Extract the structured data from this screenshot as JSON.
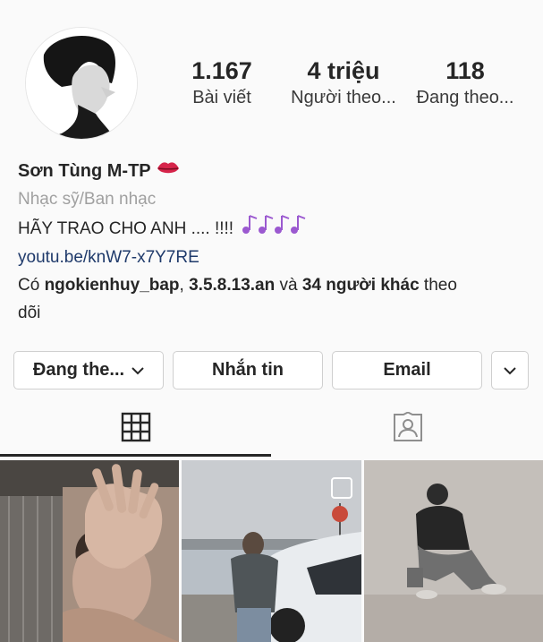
{
  "profile": {
    "stats": [
      {
        "value": "1.167",
        "label": "Bài viết"
      },
      {
        "value": "4 triệu",
        "label": "Người theo..."
      },
      {
        "value": "118",
        "label": "Đang theo..."
      }
    ],
    "name": "Sơn Tùng M-TP",
    "category": "Nhạc sỹ/Ban nhạc",
    "bio": "HÃY TRAO CHO ANH .... !!!!",
    "link": "youtu.be/knW7-x7Y7RE",
    "followed_by": {
      "prefix": "Có",
      "user1": "ngokienhuy_bap",
      "sep": ",",
      "user2": "3.5.8.13.an",
      "and": "và",
      "others": "34 người khác",
      "suffix": "theo",
      "suffix2": "dõi"
    }
  },
  "actions": {
    "following_label": "Đang the...",
    "message_label": "Nhắn tin",
    "email_label": "Email"
  },
  "tabs": [
    {
      "icon": "grid-icon",
      "active": true
    },
    {
      "icon": "tagged-person-icon",
      "active": false
    }
  ],
  "colors": {
    "link": "#1f3a6b",
    "category": "#a0a0a0",
    "music_notes": "#9b59d0",
    "lips": "#d6244a"
  }
}
